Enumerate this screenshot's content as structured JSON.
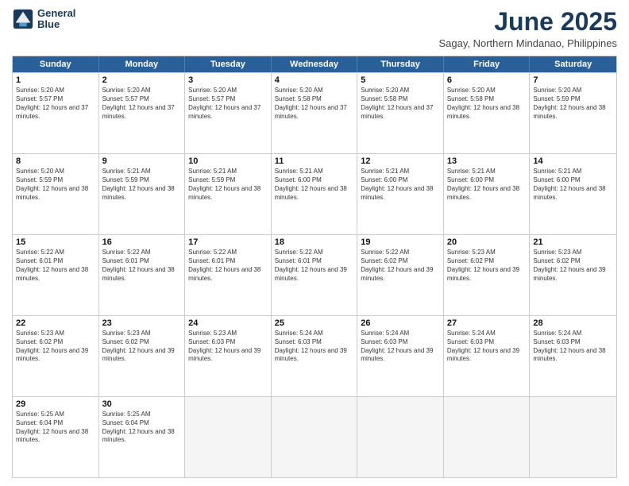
{
  "header": {
    "logo_line1": "General",
    "logo_line2": "Blue",
    "month": "June 2025",
    "location": "Sagay, Northern Mindanao, Philippines"
  },
  "weekdays": [
    "Sunday",
    "Monday",
    "Tuesday",
    "Wednesday",
    "Thursday",
    "Friday",
    "Saturday"
  ],
  "rows": [
    [
      {
        "day": "1",
        "rise": "5:20 AM",
        "set": "5:57 PM",
        "hours": "12 hours and 37 minutes."
      },
      {
        "day": "2",
        "rise": "5:20 AM",
        "set": "5:57 PM",
        "hours": "12 hours and 37 minutes."
      },
      {
        "day": "3",
        "rise": "5:20 AM",
        "set": "5:57 PM",
        "hours": "12 hours and 37 minutes."
      },
      {
        "day": "4",
        "rise": "5:20 AM",
        "set": "5:58 PM",
        "hours": "12 hours and 37 minutes."
      },
      {
        "day": "5",
        "rise": "5:20 AM",
        "set": "5:58 PM",
        "hours": "12 hours and 37 minutes."
      },
      {
        "day": "6",
        "rise": "5:20 AM",
        "set": "5:58 PM",
        "hours": "12 hours and 38 minutes."
      },
      {
        "day": "7",
        "rise": "5:20 AM",
        "set": "5:59 PM",
        "hours": "12 hours and 38 minutes."
      }
    ],
    [
      {
        "day": "8",
        "rise": "5:20 AM",
        "set": "5:59 PM",
        "hours": "12 hours and 38 minutes."
      },
      {
        "day": "9",
        "rise": "5:21 AM",
        "set": "5:59 PM",
        "hours": "12 hours and 38 minutes."
      },
      {
        "day": "10",
        "rise": "5:21 AM",
        "set": "5:59 PM",
        "hours": "12 hours and 38 minutes."
      },
      {
        "day": "11",
        "rise": "5:21 AM",
        "set": "6:00 PM",
        "hours": "12 hours and 38 minutes."
      },
      {
        "day": "12",
        "rise": "5:21 AM",
        "set": "6:00 PM",
        "hours": "12 hours and 38 minutes."
      },
      {
        "day": "13",
        "rise": "5:21 AM",
        "set": "6:00 PM",
        "hours": "12 hours and 38 minutes."
      },
      {
        "day": "14",
        "rise": "5:21 AM",
        "set": "6:00 PM",
        "hours": "12 hours and 38 minutes."
      }
    ],
    [
      {
        "day": "15",
        "rise": "5:22 AM",
        "set": "6:01 PM",
        "hours": "12 hours and 38 minutes."
      },
      {
        "day": "16",
        "rise": "5:22 AM",
        "set": "6:01 PM",
        "hours": "12 hours and 38 minutes."
      },
      {
        "day": "17",
        "rise": "5:22 AM",
        "set": "6:01 PM",
        "hours": "12 hours and 38 minutes."
      },
      {
        "day": "18",
        "rise": "5:22 AM",
        "set": "6:01 PM",
        "hours": "12 hours and 39 minutes."
      },
      {
        "day": "19",
        "rise": "5:22 AM",
        "set": "6:02 PM",
        "hours": "12 hours and 39 minutes."
      },
      {
        "day": "20",
        "rise": "5:23 AM",
        "set": "6:02 PM",
        "hours": "12 hours and 39 minutes."
      },
      {
        "day": "21",
        "rise": "5:23 AM",
        "set": "6:02 PM",
        "hours": "12 hours and 39 minutes."
      }
    ],
    [
      {
        "day": "22",
        "rise": "5:23 AM",
        "set": "6:02 PM",
        "hours": "12 hours and 39 minutes."
      },
      {
        "day": "23",
        "rise": "5:23 AM",
        "set": "6:02 PM",
        "hours": "12 hours and 39 minutes."
      },
      {
        "day": "24",
        "rise": "5:23 AM",
        "set": "6:03 PM",
        "hours": "12 hours and 39 minutes."
      },
      {
        "day": "25",
        "rise": "5:24 AM",
        "set": "6:03 PM",
        "hours": "12 hours and 39 minutes."
      },
      {
        "day": "26",
        "rise": "5:24 AM",
        "set": "6:03 PM",
        "hours": "12 hours and 39 minutes."
      },
      {
        "day": "27",
        "rise": "5:24 AM",
        "set": "6:03 PM",
        "hours": "12 hours and 39 minutes."
      },
      {
        "day": "28",
        "rise": "5:24 AM",
        "set": "6:03 PM",
        "hours": "12 hours and 38 minutes."
      }
    ],
    [
      {
        "day": "29",
        "rise": "5:25 AM",
        "set": "6:04 PM",
        "hours": "12 hours and 38 minutes."
      },
      {
        "day": "30",
        "rise": "5:25 AM",
        "set": "6:04 PM",
        "hours": "12 hours and 38 minutes."
      },
      null,
      null,
      null,
      null,
      null
    ]
  ]
}
